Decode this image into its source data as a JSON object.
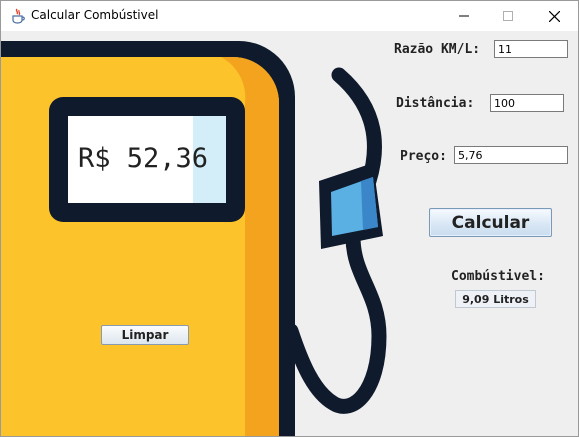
{
  "window": {
    "title": "Calcular Combústivel",
    "controls": [
      "minimize-icon",
      "maximize-icon",
      "close-icon"
    ]
  },
  "display": {
    "value": "R$ 52,36"
  },
  "form": {
    "razao_label": "Razão KM/L:",
    "razao_value": "11",
    "distancia_label": "Distância:",
    "distancia_value": "100",
    "preco_label": "Preço:",
    "preco_value": "5,76"
  },
  "actions": {
    "calcular_label": "Calcular",
    "limpar_label": "Limpar"
  },
  "result": {
    "title": "Combústivel:",
    "value": "9,09 Litros"
  },
  "colors": {
    "pump_body": "#fdc32a",
    "pump_shade": "#f3a31d",
    "outline": "#0f1a2c",
    "nozzle_blue": "#5ab0e2",
    "nozzle_blue_dark": "#3a86c8",
    "display_highlight": "#d3eef9"
  }
}
